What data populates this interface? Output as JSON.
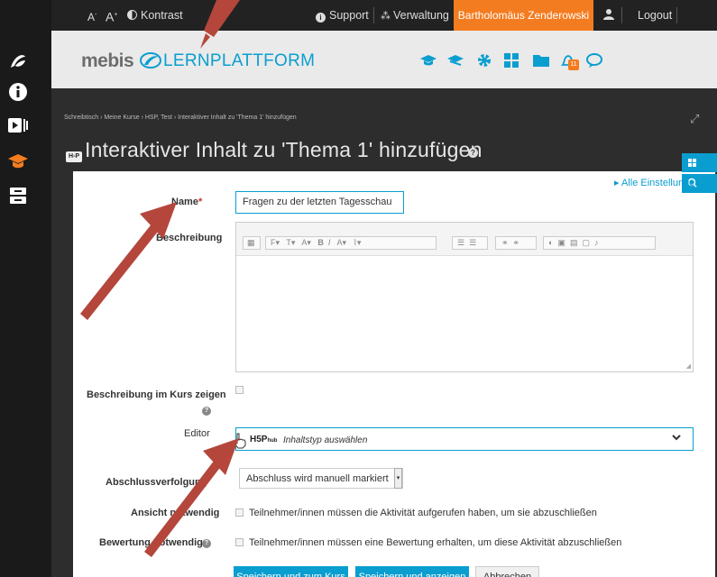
{
  "topbar": {
    "font_smaller": "A",
    "font_larger": "A",
    "contrast_label": "Kontrast",
    "support_label": "Support",
    "verwaltung_label": "Verwaltung",
    "user_name": "Bartholomäus Zenderowski",
    "logout_label": "Logout"
  },
  "header": {
    "logo_word": "mebis",
    "logo_sub": "LERNPLATTFORM",
    "notification_count": "11"
  },
  "breadcrumb": "Schreibtisch › Meine Kurse › HSP, Test › Interaktiver Inhalt zu 'Thema 1' hinzufügen",
  "page_title": "Interaktiver Inhalt zu 'Thema 1' hinzufügen",
  "title_badge": "H-P",
  "form": {
    "alle_einstellungen": "▸ Alle Einstellungen",
    "name_label": "Name",
    "name_value": "Fragen zu der letzten Tagesschau",
    "beschreibung_label": "Beschreibung",
    "show_desc_label": "Beschreibung im Kurs zeigen",
    "editor_label": "Editor",
    "h5p_brand": "H5P",
    "h5p_hub": "hub",
    "h5p_placeholder": "Inhaltstyp auswählen",
    "completion_label": "Abschlussverfolgung",
    "completion_value": "Abschluss wird manuell markiert",
    "view_label": "Ansicht notwendig",
    "view_text": "Teilnehmer/innen müssen die Aktivität aufgerufen haben, um sie abzuschließen",
    "grade_label": "Bewertung notwendig",
    "grade_text": "Teilnehmer/innen müssen eine Bewertung erhalten, um diese Aktivität abzuschließen"
  },
  "buttons": {
    "save_return": "Speichern und zum Kurs",
    "save_show": "Speichern und anzeigen",
    "cancel": "Abbrechen"
  },
  "colors": {
    "accent": "#0a9ed0",
    "user_orange": "#f47c20",
    "arrow": "#b4463c"
  }
}
